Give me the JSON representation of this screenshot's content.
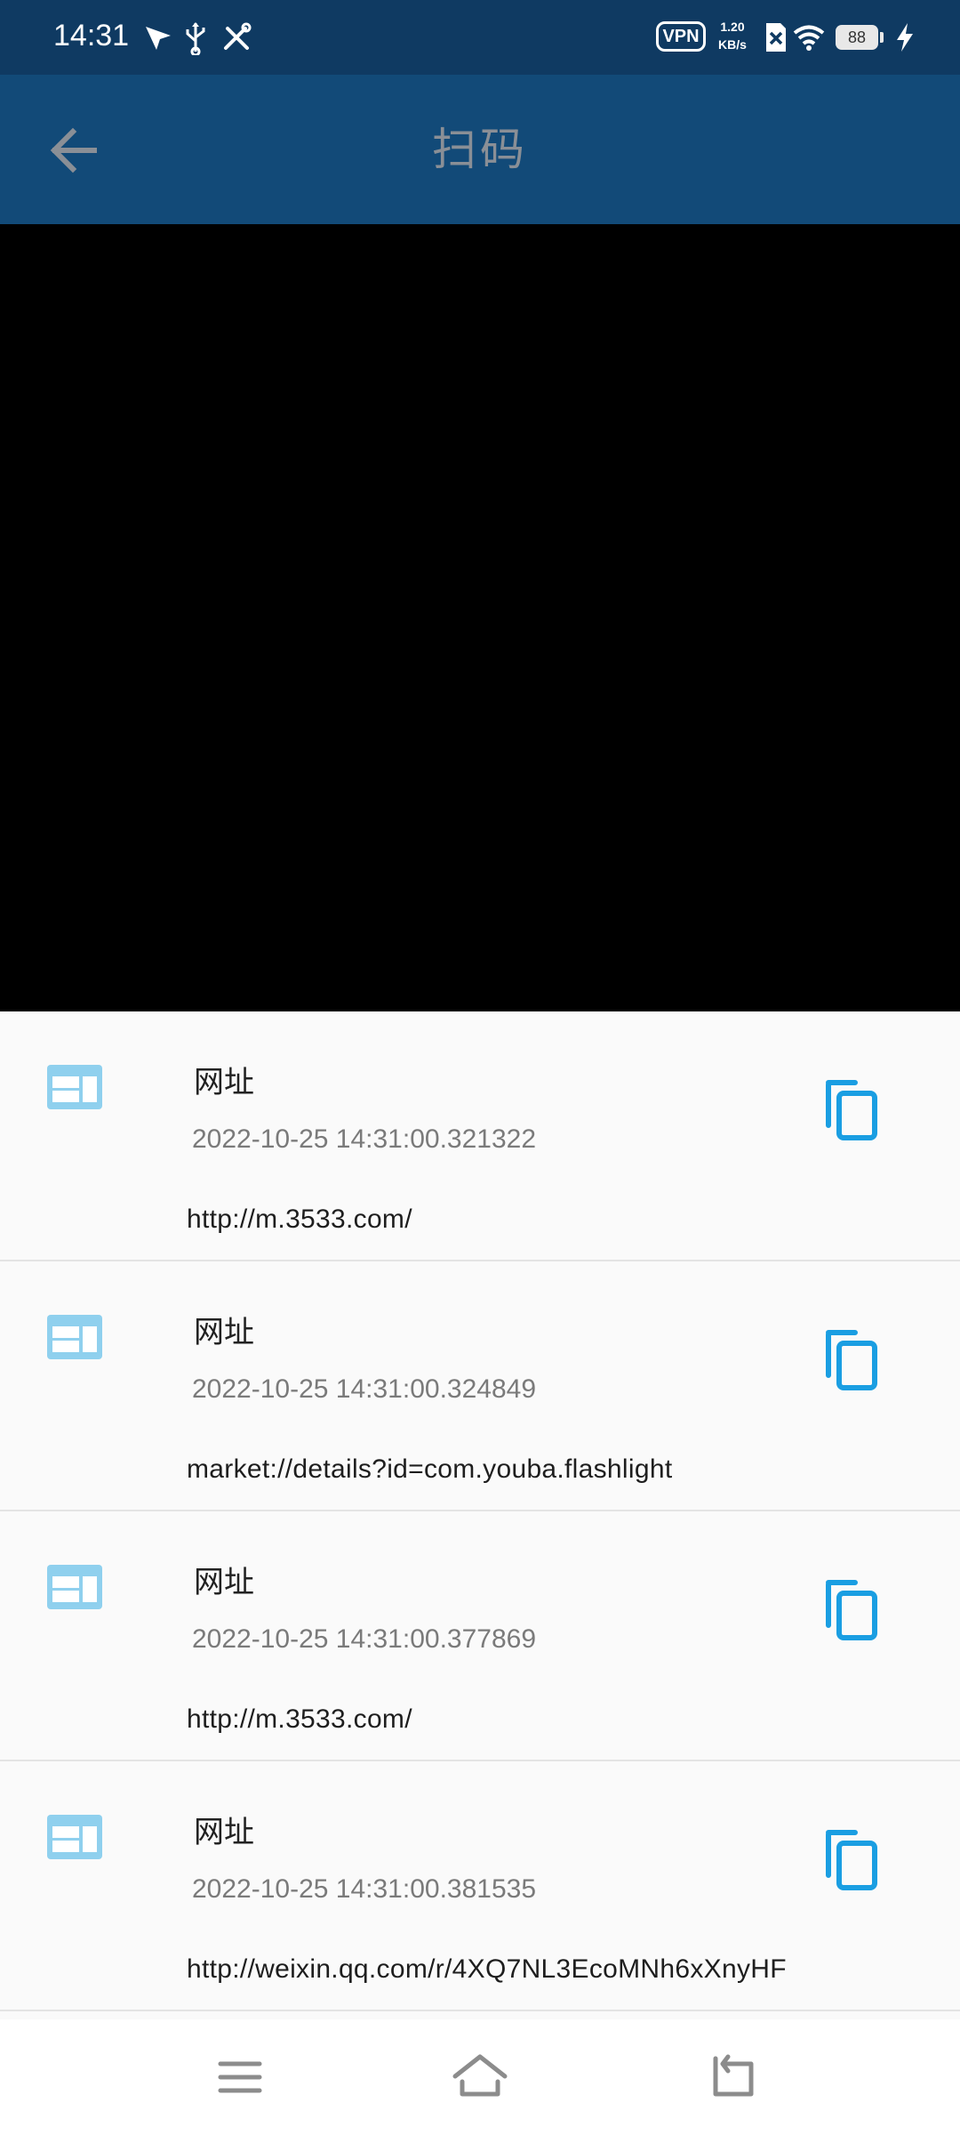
{
  "status_bar": {
    "time": "14:31",
    "vpn": "VPN",
    "net_speed_value": "1.20",
    "net_speed_unit": "KB/s",
    "battery": "88"
  },
  "app_bar": {
    "title": "扫码",
    "back_icon": "arrow-left-icon"
  },
  "results": [
    {
      "type": "网址",
      "time": "2022-10-25 14:31:00.321322",
      "content": "http://m.3533.com/"
    },
    {
      "type": "网址",
      "time": "2022-10-25 14:31:00.324849",
      "content": "market://details?id=com.youba.flashlight"
    },
    {
      "type": "网址",
      "time": "2022-10-25 14:31:00.377869",
      "content": "http://m.3533.com/"
    },
    {
      "type": "网址",
      "time": "2022-10-25 14:31:00.381535",
      "content": "http://weixin.qq.com/r/4XQ7NL3EcoMNh6xXnyHF"
    }
  ],
  "colors": {
    "status_bar_bg": "#0f3a62",
    "app_bar_bg": "#124a78",
    "title_text": "#8a8f96",
    "copy_icon": "#1a9ee2",
    "type_icon": "#8fd0ee"
  },
  "nav_bar": {
    "menu_icon": "menu-icon",
    "home_icon": "home-icon",
    "back_icon": "back-icon"
  }
}
